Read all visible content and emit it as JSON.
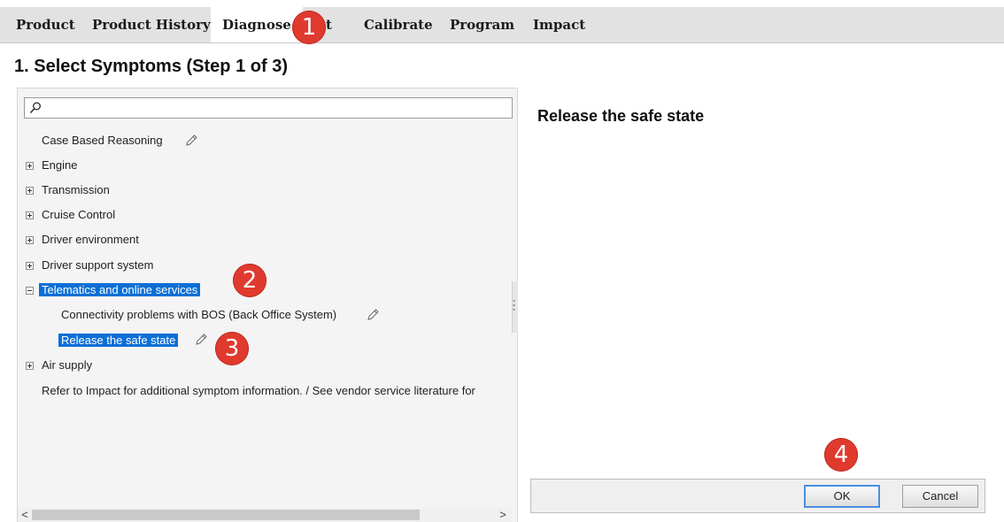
{
  "tabs": [
    {
      "label": "Product"
    },
    {
      "label": "Product History"
    },
    {
      "label": "Diagnose",
      "active": true
    },
    {
      "label": "t",
      "note": "partially hidden behind callout badge"
    },
    {
      "label": "Calibrate"
    },
    {
      "label": "Program"
    },
    {
      "label": "Impact"
    }
  ],
  "page_title": "1. Select Symptoms (Step 1 of 3)",
  "search": {
    "value": "",
    "placeholder": ""
  },
  "tree": {
    "case_based_reasoning": "Case Based Reasoning",
    "engine": "Engine",
    "transmission": "Transmission",
    "cruise_control": "Cruise Control",
    "driver_environment": "Driver environment",
    "driver_support_system": "Driver support system",
    "telematics": "Telematics and online services",
    "connectivity": "Connectivity problems with BOS (Back Office System)",
    "release_safe_state": "Release the safe state",
    "air_supply": "Air supply",
    "refer_note": "Refer to Impact for additional symptom information. / See vendor service literature for"
  },
  "detail": {
    "heading": "Release the safe state"
  },
  "buttons": {
    "ok": "OK",
    "cancel": "Cancel"
  },
  "scrollbar": {
    "left_arrow": "<",
    "right_arrow": ">"
  },
  "callouts": [
    "1",
    "2",
    "3",
    "4"
  ],
  "colors": {
    "selection": "#0a6fd6",
    "badge": "#e03a2f",
    "tabbar": "#e2e2e2",
    "panel": "#f4f4f4",
    "ok_focus": "#4a8fe0"
  },
  "icons": [
    "search-icon",
    "pencil-icon",
    "expand-icon",
    "collapse-icon"
  ]
}
